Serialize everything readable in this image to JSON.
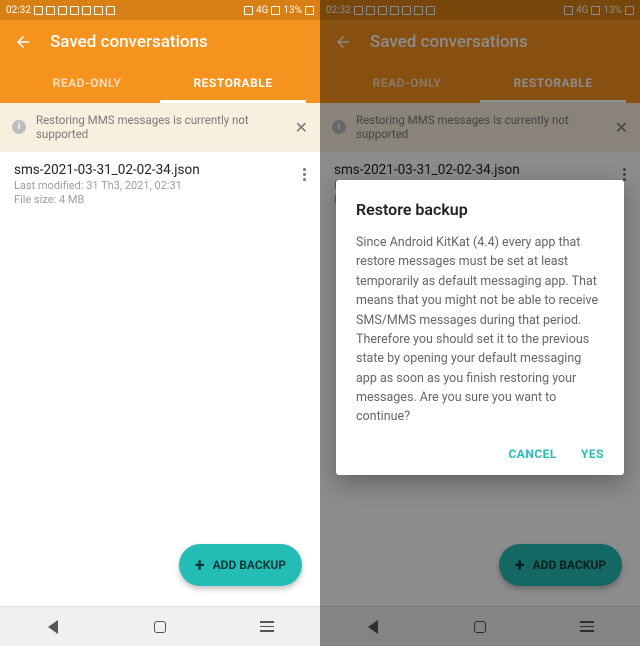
{
  "status": {
    "time": "02:32",
    "network_text": "4G",
    "battery_text": "13%"
  },
  "header": {
    "title": "Saved conversations",
    "tabs": {
      "readonly": "READ-ONLY",
      "restorable": "RESTORABLE"
    }
  },
  "banner": {
    "text": "Restoring MMS messages is currently not supported"
  },
  "file": {
    "name": "sms-2021-03-31_02-02-34.json",
    "modified": "Last modified: 31 Th3, 2021, 02:31",
    "size": "File size: 4 MB"
  },
  "fab": {
    "label": "ADD BACKUP"
  },
  "dialog": {
    "title": "Restore backup",
    "body": "Since Android KitKat (4.4) every app that restore messages must be set at least temporarily as default messaging app. That means that you might not be able to receive SMS/MMS messages during that period. Therefore you should set it to the previous state by opening your default messaging app as soon as you finish restoring your messages. Are you sure you want to continue?",
    "cancel": "CANCEL",
    "yes": "YES"
  }
}
